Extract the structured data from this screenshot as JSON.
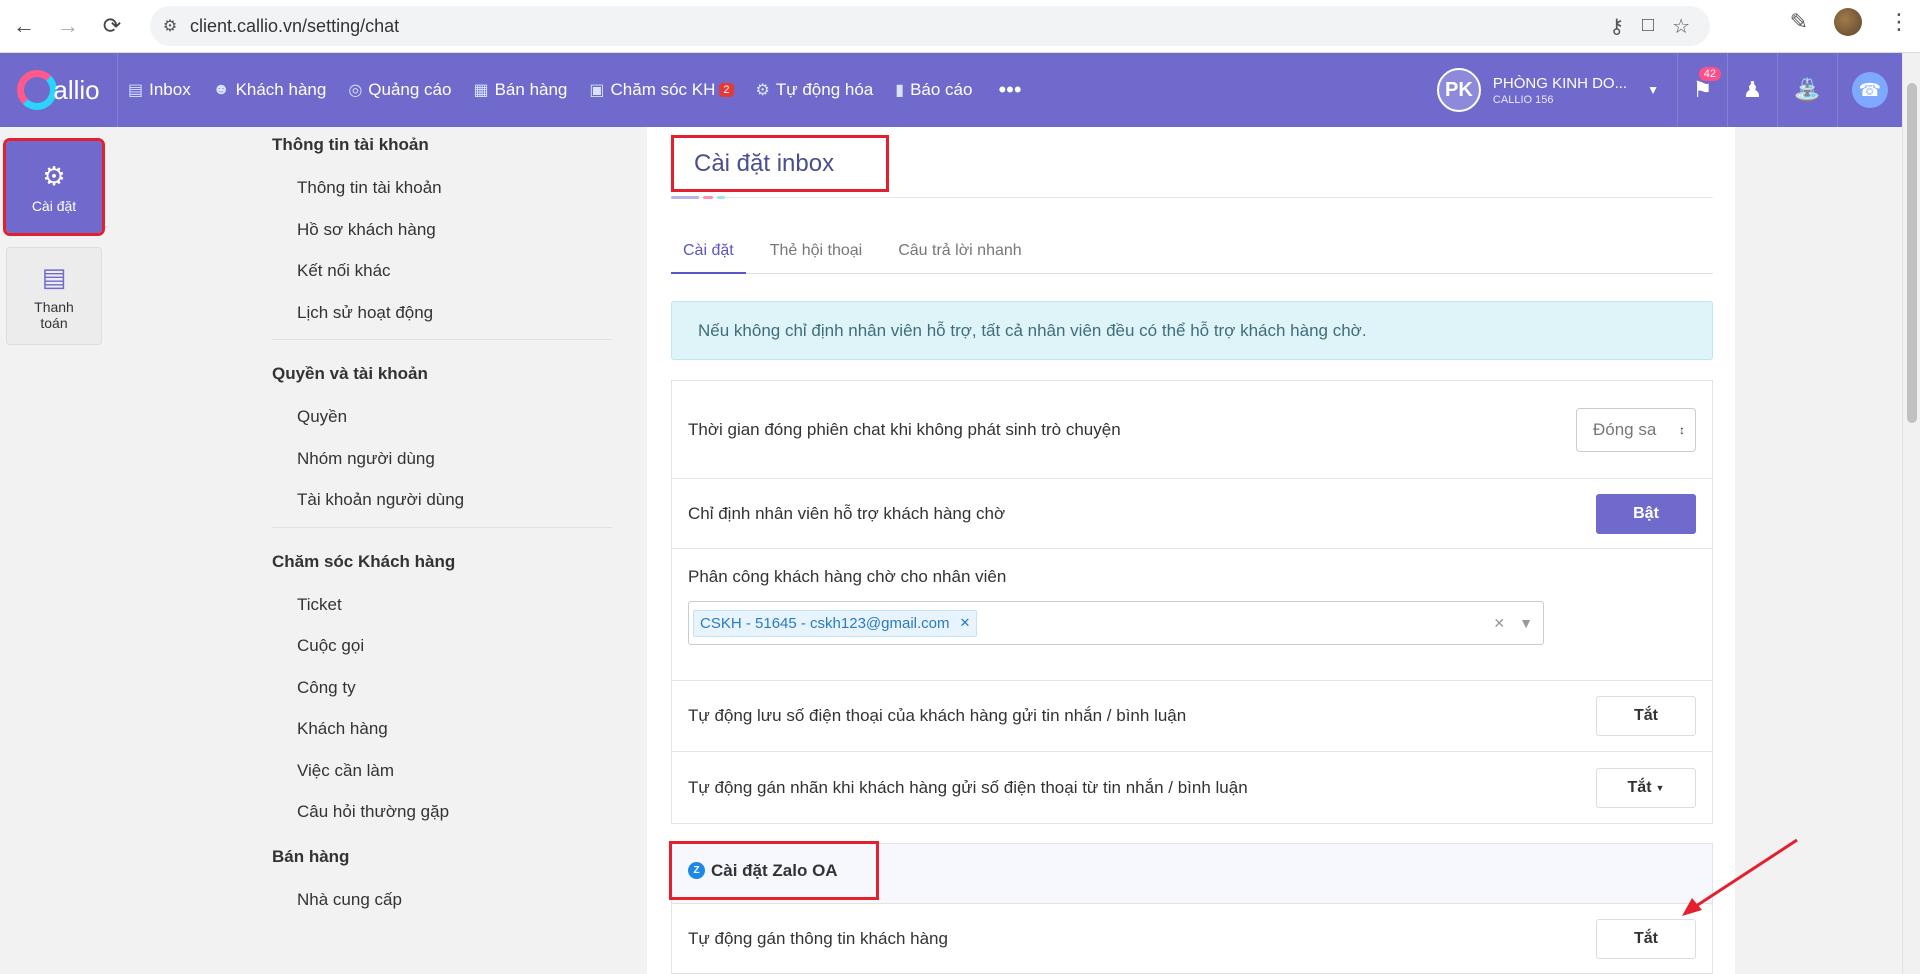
{
  "browser": {
    "url": "client.callio.vn/setting/chat",
    "back_icon": "arrow-left",
    "forward_icon": "arrow-right",
    "reload_icon": "reload"
  },
  "header": {
    "logo_text": "allio",
    "nav": [
      {
        "label": "Inbox",
        "icon": "inbox-icon"
      },
      {
        "label": "Khách hàng",
        "icon": "person-icon"
      },
      {
        "label": "Quảng cáo",
        "icon": "target-icon"
      },
      {
        "label": "Bán hàng",
        "icon": "store-icon"
      },
      {
        "label": "Chăm sóc KH",
        "icon": "care-icon",
        "badge": "2"
      },
      {
        "label": "Tự động hóa",
        "icon": "robot-icon"
      },
      {
        "label": "Báo cáo",
        "icon": "chart-icon"
      }
    ],
    "more": "•••",
    "user": {
      "initials": "PK",
      "name": "PHÒNG KINH DO...",
      "sub": "CALLIO 156"
    },
    "notifications": "42"
  },
  "rail": {
    "settings_label": "Cài đặt",
    "billing_label": "Thanh toán"
  },
  "menu": {
    "groups": [
      {
        "title": "Thông tin tài khoản",
        "items": [
          "Thông tin tài khoản",
          "Hồ sơ khách hàng",
          "Kết nối khác",
          "Lịch sử hoạt động"
        ]
      },
      {
        "title": "Quyền và tài khoản",
        "items": [
          "Quyền",
          "Nhóm người dùng",
          "Tài khoản người dùng"
        ]
      },
      {
        "title": "Chăm sóc Khách hàng",
        "items": [
          "Ticket",
          "Cuộc gọi",
          "Công ty",
          "Khách hàng",
          "Việc cần làm",
          "Câu hỏi thường gặp"
        ]
      },
      {
        "title": "Bán hàng",
        "items": [
          "Nhà cung cấp"
        ]
      }
    ]
  },
  "main": {
    "title": "Cài đặt inbox",
    "tabs": [
      "Cài đặt",
      "Thẻ hội thoại",
      "Câu trả lời nhanh"
    ],
    "alert": "Nếu không chỉ định nhân viên hỗ trợ, tất cả nhân viên đều có thể hỗ trợ khách hàng chờ.",
    "rows": {
      "close_session_label": "Thời gian đóng phiên chat khi không phát sinh trò chuyện",
      "close_session_value": "Đóng sa",
      "assign_label": "Chỉ định nhân viên hỗ trợ khách hàng chờ",
      "assign_btn": "Bật",
      "distribute_label": "Phân công khách hàng chờ cho nhân viên",
      "distribute_tag": "CSKH - 51645 - cskh123@gmail.com",
      "save_phone_label": "Tự động lưu số điện thoại của khách hàng gửi tin nhắn / bình luận",
      "save_phone_btn": "Tắt",
      "tag_label": "Tự động gán nhãn khi khách hàng gửi số điện thoại từ tin nhắn / bình luận",
      "tag_btn": "Tắt"
    },
    "zalo": {
      "title": "Cài đặt Zalo OA",
      "auto_info_label": "Tự động gán thông tin khách hàng",
      "auto_info_btn": "Tắt"
    }
  },
  "colors": {
    "primary": "#6f6acb",
    "highlight_red": "#e5202e",
    "alert_bg": "#dff4f9"
  }
}
